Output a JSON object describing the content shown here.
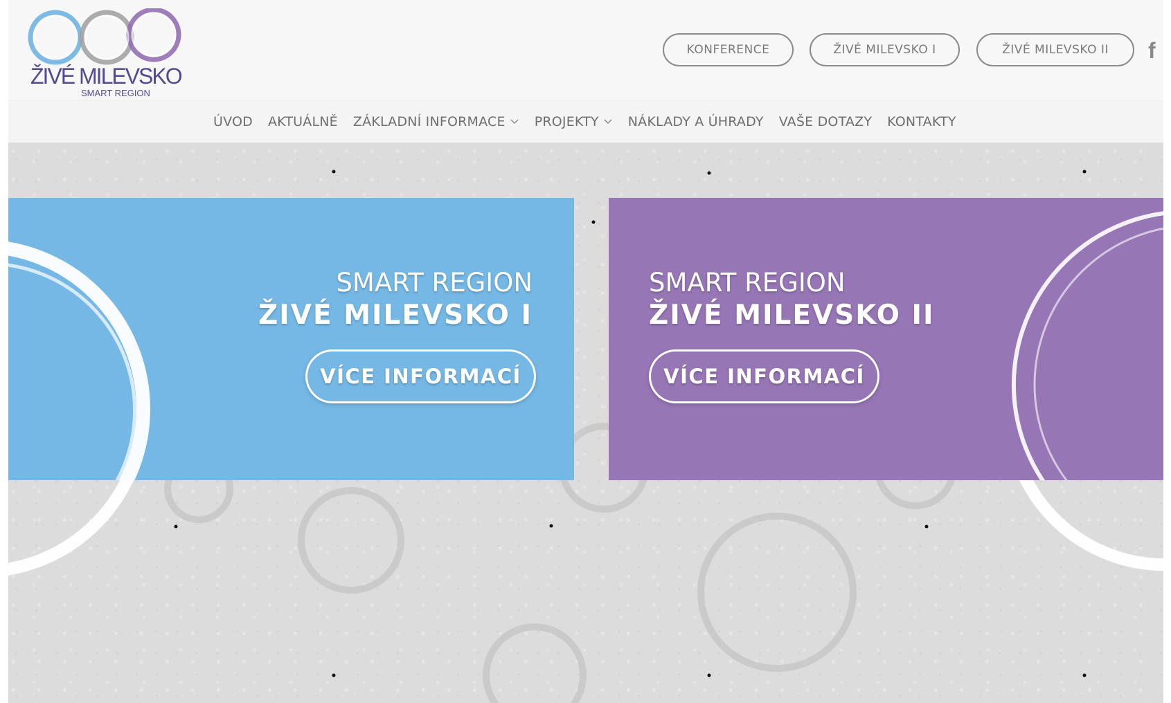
{
  "logo": {
    "title": "ŽIVÉ MILEVSKO",
    "subtitle": "SMART REGION",
    "colors": [
      "#6fb4e1",
      "#a3a3a3",
      "#9270b3"
    ],
    "text_color": "#56498f"
  },
  "top_buttons": [
    {
      "label": "KONFERENCE"
    },
    {
      "label": "ŽIVÉ MILEVSKO I"
    },
    {
      "label": "ŽIVÉ MILEVSKO II"
    }
  ],
  "social": {
    "icon": "facebook-icon",
    "glyph": "f"
  },
  "nav": {
    "items": [
      {
        "label": "ÚVOD",
        "dropdown": false
      },
      {
        "label": "AKTUÁLNĚ",
        "dropdown": false
      },
      {
        "label": "ZÁKLADNÍ INFORMACE",
        "dropdown": true
      },
      {
        "label": "PROJEKTY",
        "dropdown": true
      },
      {
        "label": "NÁKLADY A ÚHRADY",
        "dropdown": false
      },
      {
        "label": "VAŠE DOTAZY",
        "dropdown": false
      },
      {
        "label": "KONTAKTY",
        "dropdown": false
      }
    ]
  },
  "hero": {
    "panels": [
      {
        "line1": "SMART REGION",
        "line2": "ŽIVÉ MILEVSKO I",
        "button": "VÍCE INFORMACÍ",
        "color": "#75b8e5"
      },
      {
        "line1": "SMART REGION",
        "line2": "ŽIVÉ MILEVSKO II",
        "button": "VÍCE INFORMACÍ",
        "color": "#9676b5"
      }
    ]
  }
}
